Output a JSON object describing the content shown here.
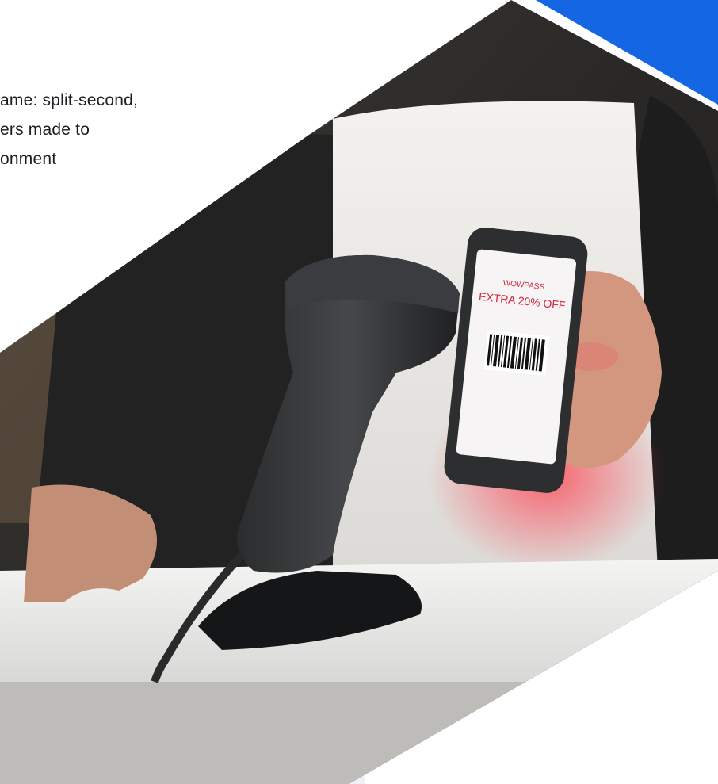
{
  "hero": {
    "line1": "ame: split-second,",
    "line2": "ers made to",
    "line3": "onment"
  },
  "phone_screen": {
    "brand": "WOWPASS",
    "offer": "EXTRA 20% OFF"
  },
  "colors": {
    "accent_blue": "#1466e3",
    "panel_grey": "#eef0f4",
    "text_dark": "#1b1d23"
  }
}
